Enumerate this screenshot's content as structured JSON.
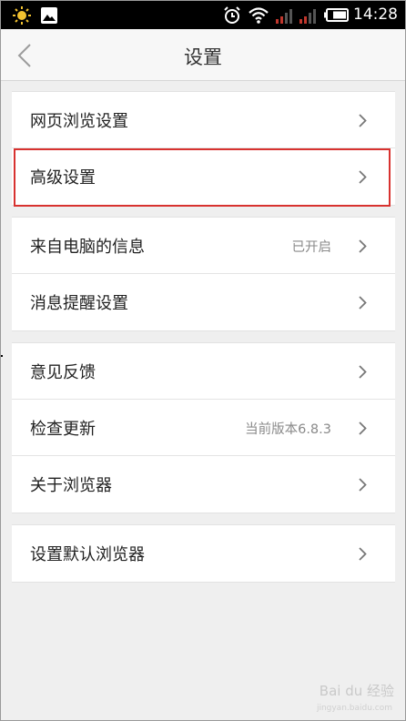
{
  "status_bar": {
    "time": "14:28",
    "icons": [
      "sun-icon",
      "image-icon",
      "alarm-icon",
      "wifi-icon",
      "signal-icon",
      "signal-icon",
      "battery-icon"
    ]
  },
  "header": {
    "title": "设置",
    "back_icon": "chevron-left-icon"
  },
  "groups": [
    {
      "items": [
        {
          "label": "网页浏览设置",
          "value": ""
        },
        {
          "label": "高级设置",
          "value": ""
        }
      ]
    },
    {
      "items": [
        {
          "label": "来自电脑的信息",
          "value": "已开启"
        },
        {
          "label": "消息提醒设置",
          "value": ""
        }
      ]
    },
    {
      "items": [
        {
          "label": "意见反馈",
          "value": ""
        },
        {
          "label": "检查更新",
          "value": "当前版本6.8.3"
        },
        {
          "label": "关于浏览器",
          "value": ""
        }
      ]
    },
    {
      "items": [
        {
          "label": "设置默认浏览器",
          "value": ""
        }
      ]
    }
  ],
  "highlight": {
    "target": "高级设置",
    "color": "#d8322f"
  },
  "watermark": {
    "text": "Bai du 经验",
    "sub": "jingyan.baidu.com"
  }
}
